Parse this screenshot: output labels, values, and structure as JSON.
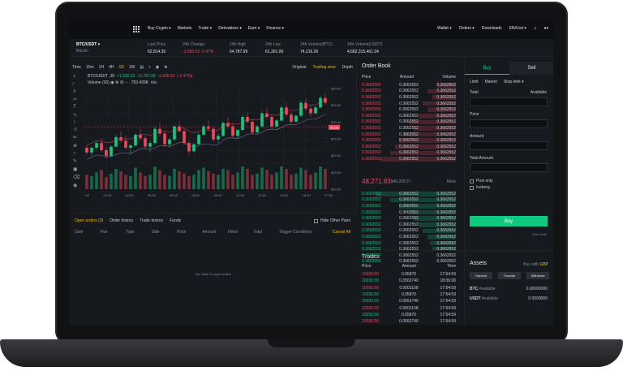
{
  "nav": {
    "menu": [
      "Buy Crypto ▾",
      "Markets",
      "Trade ▾",
      "Derivatives ▾",
      "Earn ▾",
      "Finance ▾"
    ],
    "right": [
      "Wallet ▾",
      "Orders ▾",
      "Downloads",
      "EN/Usd ▾"
    ]
  },
  "ticker": {
    "pair": "BTC/USDT",
    "pair_sub": "Bitcoin",
    "stats": [
      {
        "label": "Last Price",
        "value": "62,814.35",
        "color": "#e6e8ea"
      },
      {
        "label": "24h Change",
        "value": "-1,595.63 -2.47%",
        "color": "#f6465d"
      },
      {
        "label": "24h High",
        "value": "64,787.99",
        "color": "#e6e8ea"
      },
      {
        "label": "24h Low",
        "value": "61,301.00",
        "color": "#e6e8ea"
      },
      {
        "label": "24h Volume(BTC)",
        "value": "74,216.26",
        "color": "#e6e8ea"
      },
      {
        "label": "24h Volume(USDT)",
        "value": "4,682,315,461.04",
        "color": "#e6e8ea"
      }
    ]
  },
  "chart_tools": [
    "Time",
    "15m",
    "1H",
    "4H",
    "1D",
    "1W"
  ],
  "chart_tools_active": "1D",
  "chart_right": [
    "Original",
    "Trading view",
    "Depth"
  ],
  "chart_right_active": "Trading view",
  "indicator1": {
    "label": "BTC/USDT ,30",
    "v1": "+1,595.63",
    "v2": "+1,787.99",
    "v3": "-1,600.63",
    "v4": "(-2.47%)"
  },
  "indicator2": {
    "label": "Volume (20)",
    "v1": "783.439K",
    "v2": "n/a"
  },
  "chart_data": {
    "type": "candlestick",
    "x_ticks": [
      "22:00",
      "23:00",
      "02:00",
      "03:00",
      "05:00",
      "06:00",
      "09:00",
      "12:00",
      "13:00",
      "15:00",
      "18:00",
      "07:00"
    ],
    "y_ticks": [
      "$30,00",
      "$35,00",
      "$30,00",
      "$25,00",
      "$20,00",
      "$23,00",
      "$60,00"
    ],
    "price_label": "31,00",
    "ohlc": [
      [
        44,
        46,
        38,
        40
      ],
      [
        40,
        45,
        37,
        44
      ],
      [
        44,
        50,
        42,
        48
      ],
      [
        48,
        52,
        40,
        42
      ],
      [
        42,
        44,
        35,
        37
      ],
      [
        37,
        46,
        36,
        45
      ],
      [
        45,
        55,
        44,
        53
      ],
      [
        53,
        58,
        48,
        50
      ],
      [
        50,
        54,
        42,
        44
      ],
      [
        44,
        47,
        38,
        46
      ],
      [
        46,
        56,
        45,
        55
      ],
      [
        55,
        60,
        50,
        52
      ],
      [
        52,
        54,
        43,
        45
      ],
      [
        45,
        50,
        40,
        48
      ],
      [
        48,
        62,
        47,
        60
      ],
      [
        60,
        65,
        54,
        56
      ],
      [
        56,
        58,
        45,
        47
      ],
      [
        47,
        52,
        44,
        51
      ],
      [
        51,
        63,
        50,
        62
      ],
      [
        62,
        66,
        57,
        58
      ],
      [
        58,
        60,
        46,
        48
      ],
      [
        48,
        50,
        38,
        41
      ],
      [
        41,
        48,
        40,
        47
      ],
      [
        47,
        57,
        46,
        55
      ],
      [
        55,
        64,
        54,
        62
      ],
      [
        62,
        67,
        58,
        60
      ],
      [
        60,
        62,
        49,
        51
      ],
      [
        51,
        56,
        48,
        54
      ],
      [
        54,
        66,
        53,
        65
      ],
      [
        65,
        70,
        60,
        62
      ],
      [
        62,
        64,
        52,
        54
      ],
      [
        54,
        60,
        52,
        59
      ],
      [
        59,
        72,
        58,
        70
      ],
      [
        70,
        74,
        64,
        66
      ],
      [
        66,
        68,
        55,
        57
      ],
      [
        57,
        63,
        56,
        62
      ],
      [
        62,
        75,
        61,
        73
      ],
      [
        73,
        78,
        68,
        70
      ],
      [
        70,
        72,
        60,
        62
      ],
      [
        62,
        68,
        60,
        67
      ],
      [
        67,
        80,
        66,
        78
      ],
      [
        78,
        82,
        70,
        72
      ],
      [
        72,
        74,
        64,
        66
      ],
      [
        66,
        72,
        65,
        71
      ],
      [
        71,
        84,
        70,
        82
      ],
      [
        82,
        86,
        75,
        77
      ],
      [
        77,
        80,
        70,
        73
      ],
      [
        73,
        79,
        72,
        78
      ],
      [
        78,
        88,
        77,
        86
      ],
      [
        86,
        90,
        80,
        82
      ]
    ],
    "volume": [
      60,
      55,
      70,
      80,
      50,
      65,
      85,
      75,
      60,
      55,
      90,
      70,
      55,
      60,
      95,
      80,
      60,
      55,
      85,
      75,
      65,
      55,
      60,
      80,
      90,
      75,
      65,
      60,
      85,
      80,
      60,
      70,
      95,
      85,
      60,
      65,
      90,
      80,
      60,
      70,
      95,
      85,
      60,
      65,
      90,
      80,
      60,
      70,
      95,
      85
    ],
    "ma": [
      [
        42,
        45,
        47,
        50,
        52
      ],
      [
        48,
        50,
        52,
        54,
        56
      ]
    ]
  },
  "orders": {
    "tabs": [
      "Open orders (0)",
      "Order history",
      "Trade history",
      "Funds"
    ],
    "hide_pairs": "Hide Other Pairs",
    "columns": [
      "Date",
      "Pair",
      "Type",
      "Side",
      "Price",
      "Amount",
      "Filled",
      "Total",
      "Trigger Conditions"
    ],
    "cancel_all": "Cancel All",
    "empty": "You have no open orders"
  },
  "book": {
    "title": "Order Book",
    "columns": [
      "Price",
      "Amount",
      "Volume"
    ],
    "asks": [
      [
        "0.3662552",
        "0.3662552",
        "0.3662552"
      ],
      [
        "0.3662552",
        "0.3662552",
        "0.3662552"
      ],
      [
        "0.3662552",
        "0.3662552",
        "0.3662552"
      ],
      [
        "0.3662552",
        "0.3662552",
        "0.3662552"
      ],
      [
        "0.3662552",
        "0.3662552",
        "0.3662552"
      ],
      [
        "0.3662552",
        "0.3662552",
        "0.3662552"
      ],
      [
        "0.3662552",
        "0.3662552",
        "0.3662552"
      ],
      [
        "0.3662552",
        "0.3662552",
        "0.3662552"
      ],
      [
        "0.3662552",
        "0.3662552",
        "0.3662552"
      ],
      [
        "0.3662552",
        "0.3662552",
        "0.3662552"
      ],
      [
        "0.3662552",
        "0.3662552",
        "0.3662552"
      ],
      [
        "0.3662552",
        "0.3662552",
        "0.3662552"
      ],
      [
        "0.3662552",
        "0.3662552",
        "0.3662552"
      ]
    ],
    "ask_depth": [
      0.2,
      0.3,
      0.25,
      0.35,
      0.3,
      0.4,
      0.5,
      0.45,
      0.55,
      0.6,
      0.65,
      0.7,
      0.8
    ],
    "mid_price": "48,271.83",
    "mid_usd": "$48,209.27",
    "more": "More",
    "bids": [
      [
        "0.3662552",
        "0.3662552",
        "0.3662552"
      ],
      [
        "0.3662552",
        "0.3662552",
        "0.3662552"
      ],
      [
        "0.3662552",
        "0.3662552",
        "0.3662552"
      ],
      [
        "0.3662552",
        "0.3662552",
        "0.3662552"
      ],
      [
        "0.3662552",
        "0.3662552",
        "0.3662552"
      ],
      [
        "0.3662552",
        "0.3662552",
        "0.3662552"
      ],
      [
        "0.3662552",
        "0.3662552",
        "0.3662552"
      ],
      [
        "0.3662552",
        "0.3662552",
        "0.3662552"
      ],
      [
        "0.3662552",
        "0.3662552",
        "0.3662552"
      ],
      [
        "0.3662552",
        "0.3662552",
        "0.3662552"
      ],
      [
        "0.3662552",
        "0.3662552",
        "0.3662552"
      ],
      [
        "0.3662552",
        "0.3662552",
        "0.3662552"
      ]
    ],
    "bid_depth": [
      0.85,
      0.7,
      0.6,
      0.5,
      0.45,
      0.4,
      0.35,
      0.3,
      0.28,
      0.25,
      0.2,
      0.15
    ]
  },
  "trades": {
    "title": "Trades",
    "columns": [
      "Price",
      "Amount",
      "Time"
    ],
    "rows": [
      [
        "10393.50",
        "0.05870",
        "17:54:59",
        "red"
      ],
      [
        "10393.50",
        "0.0563740",
        "18:06:06",
        "green"
      ],
      [
        "10393.50",
        "0.0001108",
        "17:54:59",
        "red"
      ],
      [
        "10393.50",
        "0.05870",
        "17:54:59",
        "green"
      ],
      [
        "10393.50",
        "0.0563740",
        "17:54:59",
        "green"
      ],
      [
        "10393.50",
        "0.0001108",
        "17:54:59",
        "red"
      ],
      [
        "10393.50",
        "0.05870",
        "17:54:59",
        "green"
      ],
      [
        "10393.50",
        "0.0563740",
        "17:54:59",
        "red"
      ]
    ]
  },
  "trade_form": {
    "buy_tab": "Buy",
    "sell_tab": "Sell",
    "types": [
      "Limit",
      "Market",
      "Stop-limit ▾"
    ],
    "total_label": "Total",
    "available_label": "Available",
    "price_label": "Price",
    "amount_label": "Amount",
    "total_amount_label": "Total Amount",
    "post_only": "Post only",
    "iceberg": "Iceberg",
    "buy_button": "Buy",
    "fee_level": "Fee Level"
  },
  "assets": {
    "title": "Assets",
    "buy_with": "Buy with",
    "buy_with_currency": "GBP",
    "buttons": [
      "Deposit",
      "Transfer",
      "Withdraw"
    ],
    "rows": [
      {
        "coin": "BTC",
        "label": "Available",
        "value": "0.00000000"
      },
      {
        "coin": "USDT",
        "label": "Available",
        "value": "0.0000000"
      }
    ]
  },
  "colors": {
    "green": "#0ecb81",
    "red": "#f6465d",
    "gold": "#f0b90b",
    "bg": "#161a1e"
  }
}
